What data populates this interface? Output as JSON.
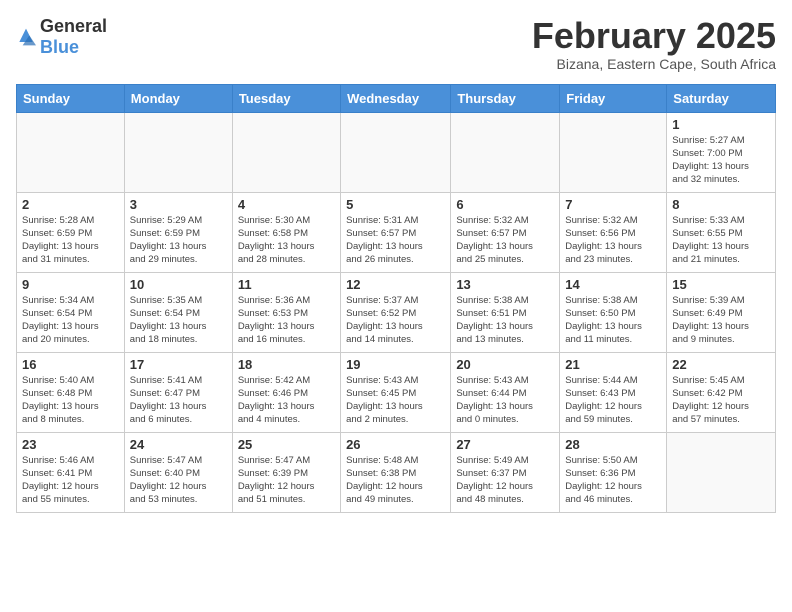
{
  "logo": {
    "general": "General",
    "blue": "Blue"
  },
  "title": "February 2025",
  "location": "Bizana, Eastern Cape, South Africa",
  "weekdays": [
    "Sunday",
    "Monday",
    "Tuesday",
    "Wednesday",
    "Thursday",
    "Friday",
    "Saturday"
  ],
  "weeks": [
    [
      {
        "day": "",
        "info": ""
      },
      {
        "day": "",
        "info": ""
      },
      {
        "day": "",
        "info": ""
      },
      {
        "day": "",
        "info": ""
      },
      {
        "day": "",
        "info": ""
      },
      {
        "day": "",
        "info": ""
      },
      {
        "day": "1",
        "info": "Sunrise: 5:27 AM\nSunset: 7:00 PM\nDaylight: 13 hours\nand 32 minutes."
      }
    ],
    [
      {
        "day": "2",
        "info": "Sunrise: 5:28 AM\nSunset: 6:59 PM\nDaylight: 13 hours\nand 31 minutes."
      },
      {
        "day": "3",
        "info": "Sunrise: 5:29 AM\nSunset: 6:59 PM\nDaylight: 13 hours\nand 29 minutes."
      },
      {
        "day": "4",
        "info": "Sunrise: 5:30 AM\nSunset: 6:58 PM\nDaylight: 13 hours\nand 28 minutes."
      },
      {
        "day": "5",
        "info": "Sunrise: 5:31 AM\nSunset: 6:57 PM\nDaylight: 13 hours\nand 26 minutes."
      },
      {
        "day": "6",
        "info": "Sunrise: 5:32 AM\nSunset: 6:57 PM\nDaylight: 13 hours\nand 25 minutes."
      },
      {
        "day": "7",
        "info": "Sunrise: 5:32 AM\nSunset: 6:56 PM\nDaylight: 13 hours\nand 23 minutes."
      },
      {
        "day": "8",
        "info": "Sunrise: 5:33 AM\nSunset: 6:55 PM\nDaylight: 13 hours\nand 21 minutes."
      }
    ],
    [
      {
        "day": "9",
        "info": "Sunrise: 5:34 AM\nSunset: 6:54 PM\nDaylight: 13 hours\nand 20 minutes."
      },
      {
        "day": "10",
        "info": "Sunrise: 5:35 AM\nSunset: 6:54 PM\nDaylight: 13 hours\nand 18 minutes."
      },
      {
        "day": "11",
        "info": "Sunrise: 5:36 AM\nSunset: 6:53 PM\nDaylight: 13 hours\nand 16 minutes."
      },
      {
        "day": "12",
        "info": "Sunrise: 5:37 AM\nSunset: 6:52 PM\nDaylight: 13 hours\nand 14 minutes."
      },
      {
        "day": "13",
        "info": "Sunrise: 5:38 AM\nSunset: 6:51 PM\nDaylight: 13 hours\nand 13 minutes."
      },
      {
        "day": "14",
        "info": "Sunrise: 5:38 AM\nSunset: 6:50 PM\nDaylight: 13 hours\nand 11 minutes."
      },
      {
        "day": "15",
        "info": "Sunrise: 5:39 AM\nSunset: 6:49 PM\nDaylight: 13 hours\nand 9 minutes."
      }
    ],
    [
      {
        "day": "16",
        "info": "Sunrise: 5:40 AM\nSunset: 6:48 PM\nDaylight: 13 hours\nand 8 minutes."
      },
      {
        "day": "17",
        "info": "Sunrise: 5:41 AM\nSunset: 6:47 PM\nDaylight: 13 hours\nand 6 minutes."
      },
      {
        "day": "18",
        "info": "Sunrise: 5:42 AM\nSunset: 6:46 PM\nDaylight: 13 hours\nand 4 minutes."
      },
      {
        "day": "19",
        "info": "Sunrise: 5:43 AM\nSunset: 6:45 PM\nDaylight: 13 hours\nand 2 minutes."
      },
      {
        "day": "20",
        "info": "Sunrise: 5:43 AM\nSunset: 6:44 PM\nDaylight: 13 hours\nand 0 minutes."
      },
      {
        "day": "21",
        "info": "Sunrise: 5:44 AM\nSunset: 6:43 PM\nDaylight: 12 hours\nand 59 minutes."
      },
      {
        "day": "22",
        "info": "Sunrise: 5:45 AM\nSunset: 6:42 PM\nDaylight: 12 hours\nand 57 minutes."
      }
    ],
    [
      {
        "day": "23",
        "info": "Sunrise: 5:46 AM\nSunset: 6:41 PM\nDaylight: 12 hours\nand 55 minutes."
      },
      {
        "day": "24",
        "info": "Sunrise: 5:47 AM\nSunset: 6:40 PM\nDaylight: 12 hours\nand 53 minutes."
      },
      {
        "day": "25",
        "info": "Sunrise: 5:47 AM\nSunset: 6:39 PM\nDaylight: 12 hours\nand 51 minutes."
      },
      {
        "day": "26",
        "info": "Sunrise: 5:48 AM\nSunset: 6:38 PM\nDaylight: 12 hours\nand 49 minutes."
      },
      {
        "day": "27",
        "info": "Sunrise: 5:49 AM\nSunset: 6:37 PM\nDaylight: 12 hours\nand 48 minutes."
      },
      {
        "day": "28",
        "info": "Sunrise: 5:50 AM\nSunset: 6:36 PM\nDaylight: 12 hours\nand 46 minutes."
      },
      {
        "day": "",
        "info": ""
      }
    ]
  ]
}
